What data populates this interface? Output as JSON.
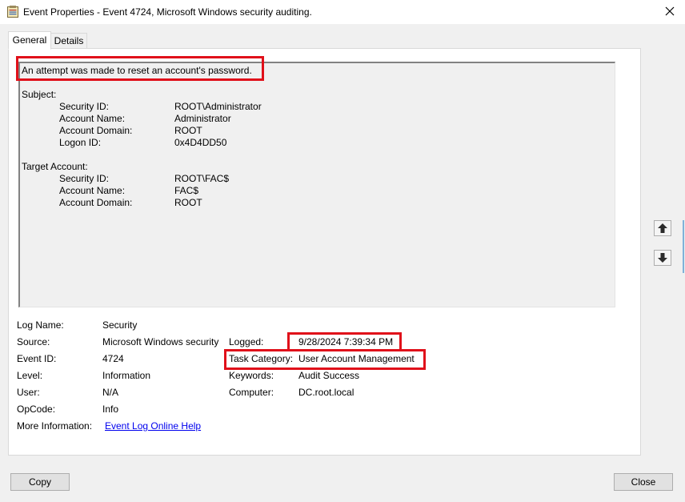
{
  "window": {
    "title": "Event Properties - Event 4724, Microsoft Windows security auditing.",
    "close_icon": "close-x"
  },
  "tabs": [
    {
      "label": "General",
      "selected": true
    },
    {
      "label": "Details",
      "selected": false
    }
  ],
  "description": {
    "headline": "An attempt was made to reset an account's password.",
    "subject": {
      "header": "Subject:",
      "fields": [
        {
          "label": "Security ID:",
          "value": "ROOT\\Administrator"
        },
        {
          "label": "Account Name:",
          "value": "Administrator"
        },
        {
          "label": "Account Domain:",
          "value": "ROOT"
        },
        {
          "label": "Logon ID:",
          "value": "0x4D4DD50"
        }
      ]
    },
    "target": {
      "header": "Target Account:",
      "fields": [
        {
          "label": "Security ID:",
          "value": "ROOT\\FAC$"
        },
        {
          "label": "Account Name:",
          "value": "FAC$"
        },
        {
          "label": "Account Domain:",
          "value": "ROOT"
        }
      ]
    }
  },
  "details": {
    "log_name": {
      "label": "Log Name:",
      "value": "Security"
    },
    "source": {
      "label": "Source:",
      "value": "Microsoft Windows security"
    },
    "event_id": {
      "label": "Event ID:",
      "value": "4724"
    },
    "level": {
      "label": "Level:",
      "value": "Information"
    },
    "user": {
      "label": "User:",
      "value": "N/A"
    },
    "opcode": {
      "label": "OpCode:",
      "value": "Info"
    },
    "more_info": {
      "label": "More Information:",
      "link": "Event Log Online Help"
    },
    "logged": {
      "label": "Logged:",
      "value": "9/28/2024 7:39:34 PM"
    },
    "task_category": {
      "label": "Task Category:",
      "value": "User Account Management"
    },
    "keywords": {
      "label": "Keywords:",
      "value": "Audit Success"
    },
    "computer": {
      "label": "Computer:",
      "value": "DC.root.local"
    }
  },
  "buttons": {
    "copy": "Copy",
    "close": "Close"
  },
  "colors": {
    "highlight": "#e0101a",
    "link": "#0000ee",
    "background": "#f0f0f0"
  }
}
